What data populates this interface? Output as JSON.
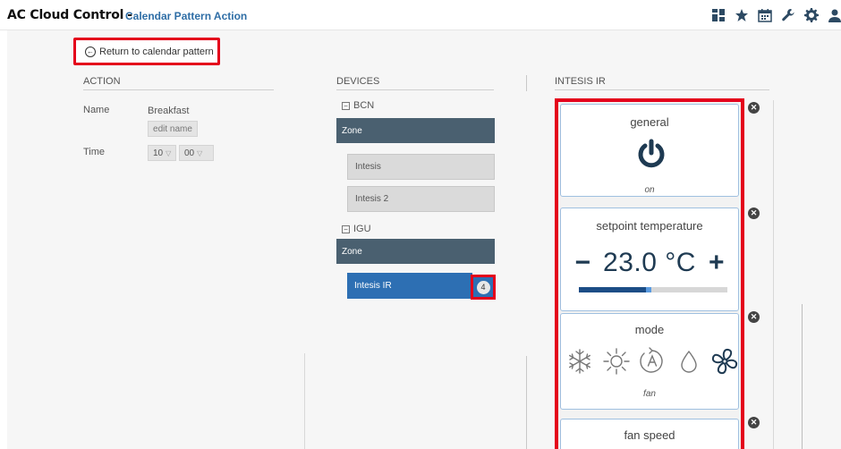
{
  "header": {
    "app_title": "AC Cloud Control",
    "separator": "-",
    "page_title": "Calendar Pattern Action",
    "icons": [
      "dashboard-icon",
      "star-icon",
      "calendar-icon",
      "wrench-icon",
      "gear-icon",
      "user-icon"
    ]
  },
  "nav": {
    "return_label": "Return to calendar pattern"
  },
  "action": {
    "heading": "ACTION",
    "name_label": "Name",
    "name_value": "Breakfast",
    "edit_name_label": "edit name",
    "time_label": "Time",
    "time_hour": "10",
    "time_minute": "00"
  },
  "devices": {
    "heading": "DEVICES",
    "groups": [
      {
        "name": "BCN",
        "zone": "Zone",
        "items": [
          "Intesis",
          "Intesis 2"
        ]
      },
      {
        "name": "IGU",
        "zone": "Zone",
        "items": [
          "Intesis IR"
        ],
        "selected": "Intesis IR",
        "badge": "4"
      }
    ]
  },
  "intesis": {
    "heading": "INTESIS IR",
    "cards": {
      "general": {
        "title": "general",
        "state": "on"
      },
      "setpoint": {
        "title": "setpoint temperature",
        "minus": "−",
        "value": "23.0 °C",
        "plus": "+",
        "level_fraction": 0.45
      },
      "mode": {
        "title": "mode",
        "options": [
          "cool",
          "heat",
          "auto",
          "dry",
          "fan"
        ],
        "selected": "fan"
      },
      "fan": {
        "title": "fan speed"
      }
    }
  },
  "colors": {
    "accent_blue": "#2d6fb3",
    "dark_navy": "#1e3a52",
    "zone_bar": "#4a6070",
    "highlight_red": "#e4001b"
  }
}
